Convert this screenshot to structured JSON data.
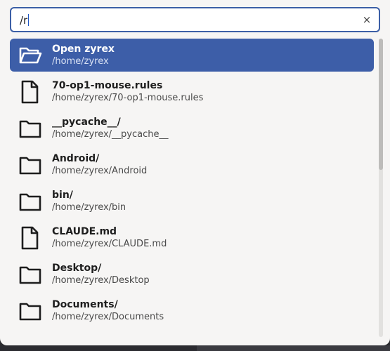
{
  "search": {
    "value": "/r",
    "clear_icon": "close-icon",
    "clear_glyph": "×"
  },
  "results": [
    {
      "title": "Open zyrex",
      "path": "/home/zyrex",
      "icon": "folder-open-icon",
      "selected": true
    },
    {
      "title": "70-op1-mouse.rules",
      "path": "/home/zyrex/70-op1-mouse.rules",
      "icon": "file-icon",
      "selected": false
    },
    {
      "title": "__pycache__/",
      "path": "/home/zyrex/__pycache__",
      "icon": "folder-icon",
      "selected": false
    },
    {
      "title": "Android/",
      "path": "/home/zyrex/Android",
      "icon": "folder-icon",
      "selected": false
    },
    {
      "title": "bin/",
      "path": "/home/zyrex/bin",
      "icon": "folder-icon",
      "selected": false
    },
    {
      "title": "CLAUDE.md",
      "path": "/home/zyrex/CLAUDE.md",
      "icon": "file-icon",
      "selected": false
    },
    {
      "title": "Desktop/",
      "path": "/home/zyrex/Desktop",
      "icon": "folder-icon",
      "selected": false
    },
    {
      "title": "Documents/",
      "path": "/home/zyrex/Documents",
      "icon": "folder-icon",
      "selected": false
    }
  ],
  "colors": {
    "accent": "#3d5ea8",
    "focus_border": "#3c5fa6",
    "background": "#f6f5f4"
  },
  "scroll": {
    "position_fraction": 0.0,
    "visible_fraction": 0.44
  }
}
